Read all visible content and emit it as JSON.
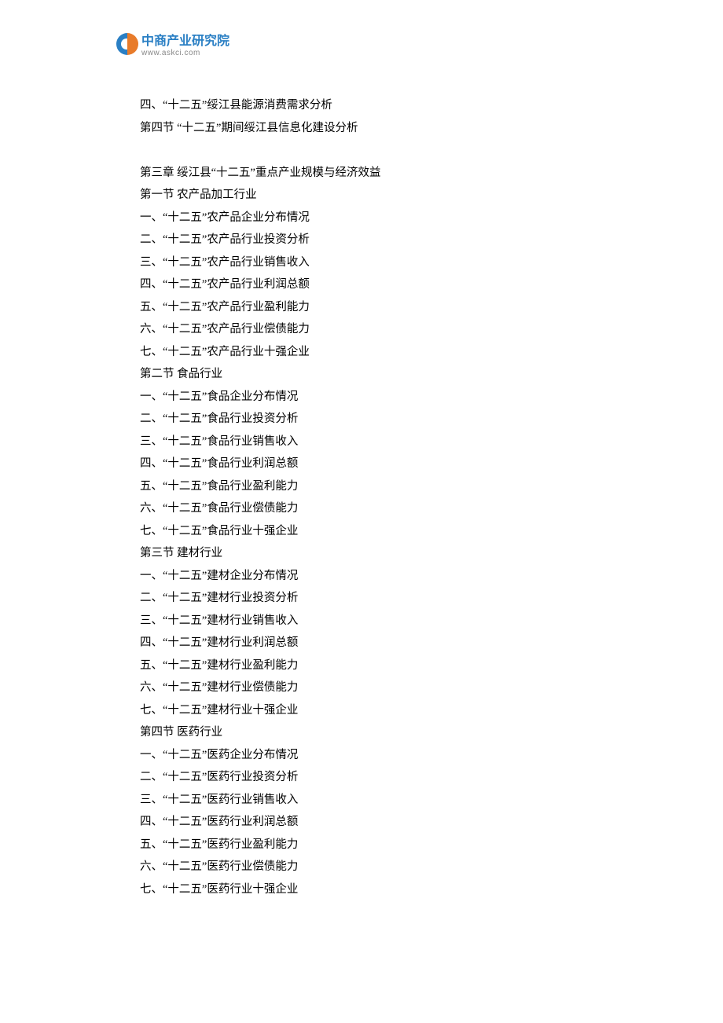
{
  "logo": {
    "cn": "中商产业研究院",
    "url": "www.askci.com"
  },
  "lines": [
    "四、“十二五”绥江县能源消费需求分析",
    "第四节  “十二五”期间绥江县信息化建设分析",
    "",
    "第三章  绥江县“十二五”重点产业规模与经济效益",
    "第一节  农产品加工行业",
    "一、“十二五”农产品企业分布情况",
    "二、“十二五”农产品行业投资分析",
    "三、“十二五”农产品行业销售收入",
    "四、“十二五”农产品行业利润总额",
    "五、“十二五”农产品行业盈利能力",
    "六、“十二五”农产品行业偿债能力",
    "七、“十二五”农产品行业十强企业",
    "第二节  食品行业",
    "一、“十二五”食品企业分布情况",
    "二、“十二五”食品行业投资分析",
    "三、“十二五”食品行业销售收入",
    "四、“十二五”食品行业利润总额",
    "五、“十二五”食品行业盈利能力",
    "六、“十二五”食品行业偿债能力",
    "七、“十二五”食品行业十强企业",
    "第三节  建材行业",
    "一、“十二五”建材企业分布情况",
    "二、“十二五”建材行业投资分析",
    "三、“十二五”建材行业销售收入",
    "四、“十二五”建材行业利润总额",
    "五、“十二五”建材行业盈利能力",
    "六、“十二五”建材行业偿债能力",
    "七、“十二五”建材行业十强企业",
    "第四节  医药行业",
    "一、“十二五”医药企业分布情况",
    "二、“十二五”医药行业投资分析",
    "三、“十二五”医药行业销售收入",
    "四、“十二五”医药行业利润总额",
    "五、“十二五”医药行业盈利能力",
    "六、“十二五”医药行业偿债能力",
    "七、“十二五”医药行业十强企业"
  ]
}
